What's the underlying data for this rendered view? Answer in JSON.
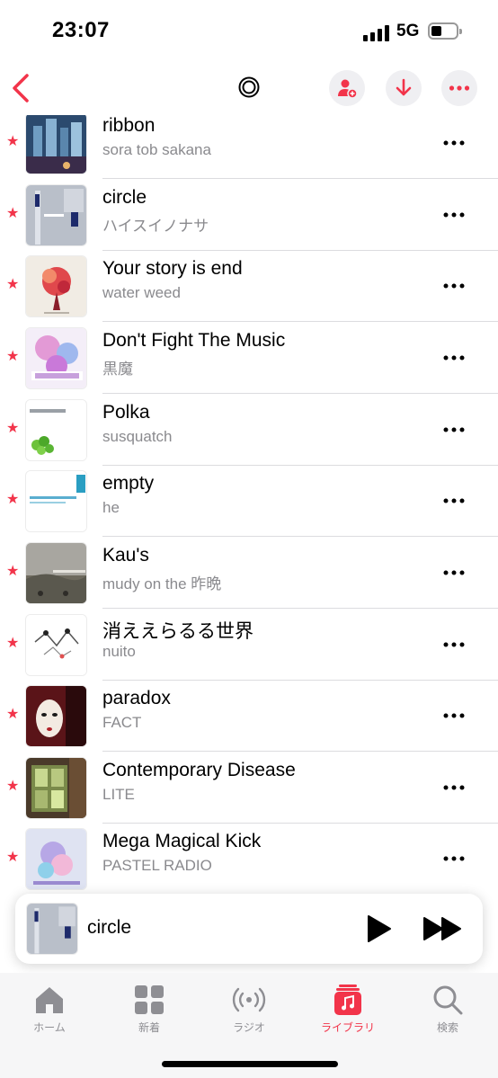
{
  "status_bar": {
    "time": "23:07",
    "network": "5G"
  },
  "colors": {
    "accent": "#f2344a",
    "secondary_text": "#8a8a8e"
  },
  "nav": {
    "back_icon": "chevron-left-icon",
    "center_icon": "target-icon",
    "actions": [
      "add-person-icon",
      "download-icon",
      "more-icon"
    ]
  },
  "songs": [
    {
      "title": "ribbon",
      "artist": "sora tob sakana",
      "favorite": true
    },
    {
      "title": "circle",
      "artist": "ハイスイノナサ",
      "favorite": true
    },
    {
      "title": "Your story is end",
      "artist": "water weed",
      "favorite": true
    },
    {
      "title": "Don't Fight The Music",
      "artist": "黒魔",
      "favorite": true
    },
    {
      "title": "Polka",
      "artist": "susquatch",
      "favorite": true
    },
    {
      "title": "empty",
      "artist": "he",
      "favorite": true
    },
    {
      "title": "Kau's",
      "artist": "mudy on the 昨晩",
      "favorite": true
    },
    {
      "title": "消ええらるる世界",
      "artist": "nuito",
      "favorite": true
    },
    {
      "title": "paradox",
      "artist": "FACT",
      "favorite": true
    },
    {
      "title": "Contemporary Disease",
      "artist": "LITE",
      "favorite": true
    },
    {
      "title": "Mega Magical Kick",
      "artist": "PASTEL RADIO",
      "favorite": true
    }
  ],
  "now_playing": {
    "title": "circle"
  },
  "tabs": [
    {
      "label": "ホーム",
      "icon": "home-icon",
      "active": false
    },
    {
      "label": "新着",
      "icon": "grid-icon",
      "active": false
    },
    {
      "label": "ラジオ",
      "icon": "radio-icon",
      "active": false
    },
    {
      "label": "ライブラリ",
      "icon": "music-library-icon",
      "active": true
    },
    {
      "label": "検索",
      "icon": "search-icon",
      "active": false
    }
  ]
}
